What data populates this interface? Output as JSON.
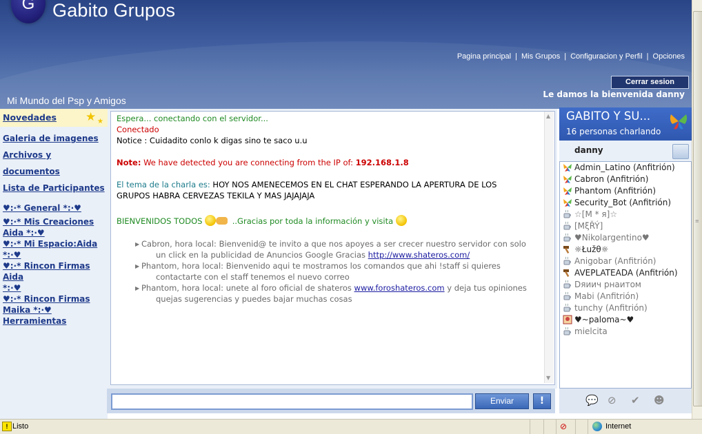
{
  "header": {
    "logo_letter": "G",
    "brand": "Gabito Grupos",
    "nav": [
      "Pagina principal",
      "Mis Grupos",
      "Configuracion y Perfil",
      "Opciones"
    ],
    "nav_separator": "|",
    "logout": "Cerrar sesion",
    "welcome": "Le damos la bienvenida danny",
    "group_name": "Mi Mundo del Psp y Amigos"
  },
  "sidebar": {
    "items": [
      "Novedades",
      "Galeria de imagenes",
      "Archivos y documentos",
      "Lista de Participantes",
      "♥:·* General *:·♥",
      "♥:·* Mis Creaciones",
      "Aida *:·♥",
      "♥:·* Mi Espacio:Aida",
      "*:·♥",
      "♥:·* Rincon Firmas Aida",
      "*:·♥",
      "♥:·* Rincon Firmas",
      "Maika *:·♥",
      "Herramientas"
    ]
  },
  "chat": {
    "connecting": "Espera... conectando con el servidor...",
    "connected": "Conectado",
    "notice": "Notice : Cuidadito conlo k digas sino te saco u.u",
    "note_label": "Note:",
    "note_text": "We have detected you are connecting from the IP of:",
    "ip": "192.168.1.8",
    "topic_label": "El tema de la charla es:",
    "topic_line1": "HOY NOS AMENECEMOS EN EL CHAT ESPERANDO LA APERTURA DE LOS",
    "topic_line2": "GRUPOS HABRA CERVEZAS TEKILA Y MAS JAJAJAJA",
    "welcome_left": "BIENVENIDOS TODOS",
    "welcome_right": "..Gracias por toda la información y visita",
    "messages": [
      {
        "line1": "Cabron, hora local: Bienvenid@ te invito a que nos apoyes a ser crecer nuestro servidor con solo",
        "line2_pre": "un click en la publicidad de Anuncios Google Gracias ",
        "link": "http://www.shateros.com/",
        "line2_post": ""
      },
      {
        "line1": "Phantom, hora local: Bienvenido aqui te mostramos los comandos que ahi !staff si quieres",
        "line2_pre": "contactarte con el staff tenemos el nuevo correo",
        "link": "",
        "line2_post": ""
      },
      {
        "line1_pre": "Phantom, hora local: unete al foro oficial de shateros ",
        "line1_link": "www.foroshateros.com",
        "line1_post": " y deja tus opiniones",
        "line2_pre": "quejas sugerencias y puedes bajar muchas cosas"
      }
    ],
    "input_value": "",
    "send": "Enviar",
    "alert": "!"
  },
  "room": {
    "title": "GABITO Y SU...",
    "count": "16 personas charlando",
    "me": "danny",
    "users": [
      {
        "name": "Admin_Latino (Anfitrión)",
        "style": "dark",
        "icon": "msn-butterfly-icon"
      },
      {
        "name": "Cabron (Anfitrión)",
        "style": "dark",
        "icon": "msn-butterfly-icon"
      },
      {
        "name": "Phantom (Anfitrión)",
        "style": "dark",
        "icon": "msn-butterfly-icon"
      },
      {
        "name": "Security_Bot (Anfitrión)",
        "style": "dark",
        "icon": "msn-butterfly-icon"
      },
      {
        "name": "☆[M * я]☆",
        "style": "grey",
        "icon": "coffee-cup-icon"
      },
      {
        "name": "[MξŘÝ]",
        "style": "grey",
        "icon": "coffee-cup-icon"
      },
      {
        "name": "♥Nikolargentino♥",
        "style": "grey",
        "icon": "coffee-cup-icon"
      },
      {
        "name": "☼Łužθ☼",
        "style": "dark",
        "icon": "hammer-icon"
      },
      {
        "name": "Anigobar (Anfitrión)",
        "style": "grey",
        "icon": "coffee-cup-icon"
      },
      {
        "name": "AVEPLATEADA (Anfitrión)",
        "style": "dark",
        "icon": "hammer-icon"
      },
      {
        "name": "Dяиич рнаитом",
        "style": "grey",
        "icon": "coffee-cup-icon"
      },
      {
        "name": "Mabi (Anfitrión)",
        "style": "grey",
        "icon": "coffee-cup-icon"
      },
      {
        "name": "tunchy (Anfitrión)",
        "style": "grey",
        "icon": "coffee-cup-icon"
      },
      {
        "name": "♥~paloma~♥",
        "style": "dark",
        "icon": "avatar-badge-icon"
      },
      {
        "name": "mielcita",
        "style": "grey",
        "icon": "coffee-cup-icon"
      }
    ]
  },
  "statusbar": {
    "status": "Listo",
    "zone": "Internet"
  },
  "colors": {
    "header": "#3e5c9e",
    "sidebar_link": "#1e3a8a",
    "green": "#1f8a22",
    "red": "#cc0000"
  }
}
